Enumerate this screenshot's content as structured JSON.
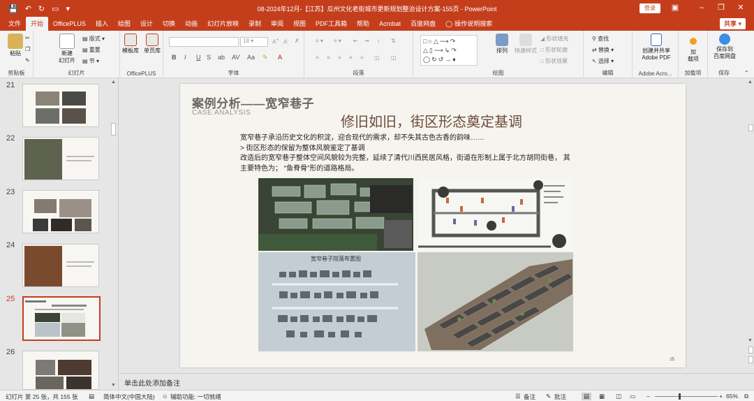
{
  "title_bar": {
    "doc_title": "08-2024年12月-【江苏】瓜州文化老街城市更新规划整治设计方案-155页  -  PowerPoint",
    "login": "登录"
  },
  "tabs": [
    "文件",
    "开始",
    "OfficePLUS",
    "插入",
    "绘图",
    "设计",
    "切换",
    "动画",
    "幻灯片放映",
    "录制",
    "审阅",
    "视图",
    "PDF工具箱",
    "帮助",
    "Acrobat",
    "百度网盘"
  ],
  "active_tab": "开始",
  "tell_me": "操作说明搜索",
  "share": "共享",
  "ribbon": {
    "clipboard": {
      "paste": "粘贴",
      "label": "剪贴板"
    },
    "slides": {
      "new_slide": "新建\n幻灯片",
      "layout": "版式",
      "reset": "重置",
      "section": "节",
      "label": "幻灯片"
    },
    "officeplus": {
      "template": "模板库",
      "single": "单页库",
      "label": "OfficePLUS"
    },
    "font": {
      "size": "18",
      "label": "字体"
    },
    "paragraph": {
      "label": "段落"
    },
    "drawing": {
      "arrange": "排列",
      "quick_styles": "快速样式",
      "fill": "形状填充",
      "outline": "形状轮廓",
      "effects": "形状效果",
      "label": "绘图"
    },
    "editing": {
      "find": "查找",
      "replace": "替换",
      "select": "选择",
      "label": "编辑"
    },
    "adobe": {
      "create": "创建并共享\nAdobe PDF",
      "label": "Adobe Acro..."
    },
    "addins": {
      "add": "加\n载项",
      "label": "加载项"
    },
    "save": {
      "save_to": "保存到\n百度网盘",
      "label": "保存"
    }
  },
  "thumbnails": [
    {
      "num": "21",
      "active": false
    },
    {
      "num": "22",
      "active": false
    },
    {
      "num": "23",
      "active": false
    },
    {
      "num": "24",
      "active": false
    },
    {
      "num": "25",
      "active": true
    },
    {
      "num": "26",
      "active": false
    }
  ],
  "slide": {
    "title": "案例分析——宽窄巷子",
    "subtitle": "CASE ANALYSIS",
    "heading": "修旧如旧，街区形态奠定基调",
    "line1": "宽窄巷子承沿历史文化的积淀，迎合现代的需求，却不失其古色古香的韵味……",
    "line2": ">  街区形态的保留为整体风貌鉴定了基调",
    "line3": "改造后的宽窄巷子整体空间风貌较为完整，延续了清代川西民居风格，街道在形制上属于北方胡同街巷，  其",
    "line4": "主要特色为；  “鱼脊骨”形的道路格局。",
    "map_title": "宽窄巷子院落布置图",
    "page_number": "25"
  },
  "notes_placeholder": "单击此处添加备注",
  "status": {
    "slide_info": "幻灯片 第 25 张，共 155 张",
    "language": "简体中文(中国大陆)",
    "accessibility": "辅助功能: 一切就绪",
    "notes": "备注",
    "comments": "批注",
    "zoom": "65%"
  },
  "colors": {
    "accent": "#c43e1c",
    "ribbon": "#f3f3f3",
    "workspace": "#e6e6e6"
  }
}
